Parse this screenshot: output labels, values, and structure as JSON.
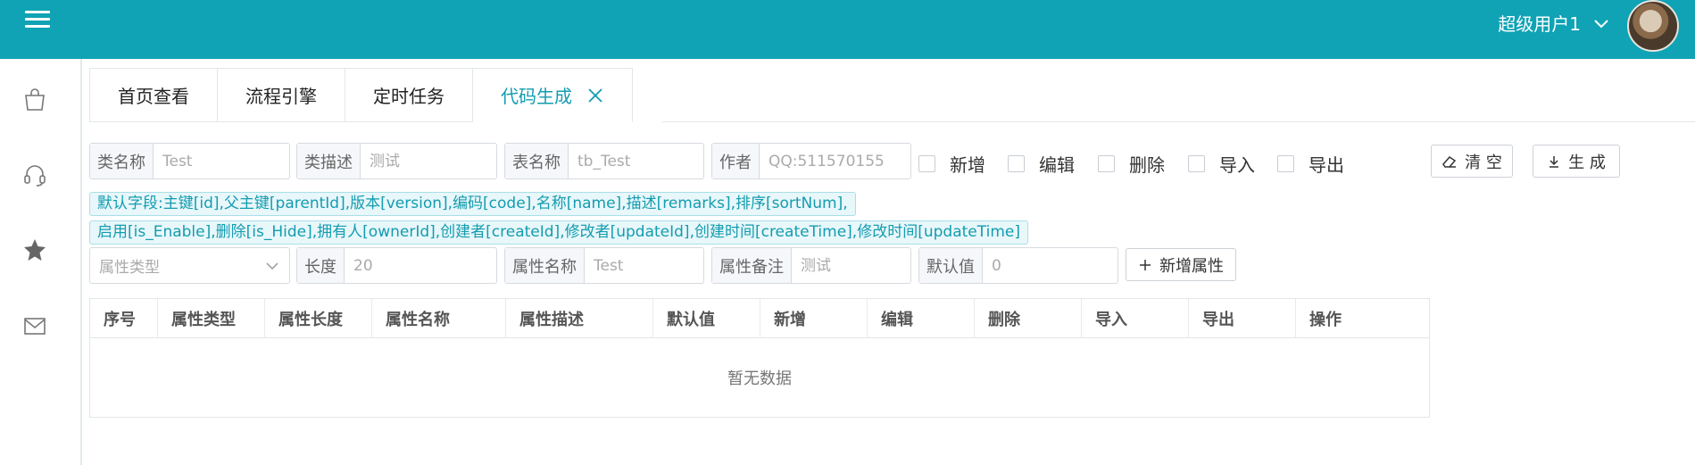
{
  "header": {
    "user_name": "超级用户1",
    "icons": [
      "menu-icon",
      "chevron-down-icon",
      "avatar"
    ]
  },
  "sidebar": {
    "icons": [
      "bag-icon",
      "headset-icon",
      "star-icon",
      "mail-icon"
    ]
  },
  "tabs": [
    {
      "label": "首页查看"
    },
    {
      "label": "流程引擎"
    },
    {
      "label": "定时任务"
    },
    {
      "label": "代码生成",
      "active": true
    }
  ],
  "form": {
    "class_name": {
      "label": "类名称",
      "placeholder": "Test"
    },
    "class_desc": {
      "label": "类描述",
      "placeholder": "测试"
    },
    "table_name": {
      "label": "表名称",
      "placeholder": "tb_Test"
    },
    "author": {
      "label": "作者",
      "placeholder": "QQ:511570155"
    },
    "checks": [
      "新增",
      "编辑",
      "删除",
      "导入",
      "导出"
    ],
    "clear_label": "清 空",
    "generate_label": "生 成"
  },
  "defaults": {
    "line1": "默认字段:主键[id],父主键[parentId],版本[version],编码[code],名称[name],描述[remarks],排序[sortNum],",
    "line2": "启用[is_Enable],删除[is_Hide],拥有人[ownerId],创建者[createId],修改者[updateId],创建时间[createTime],修改时间[updateTime]"
  },
  "attr": {
    "type_placeholder": "属性类型",
    "length": {
      "label": "长度",
      "placeholder": "20"
    },
    "name": {
      "label": "属性名称",
      "placeholder": "Test"
    },
    "remark": {
      "label": "属性备注",
      "placeholder": "测试"
    },
    "default": {
      "label": "默认值",
      "placeholder": "0"
    },
    "add_label": "新增属性"
  },
  "table": {
    "columns": [
      "序号",
      "属性类型",
      "属性长度",
      "属性名称",
      "属性描述",
      "默认值",
      "新增",
      "编辑",
      "删除",
      "导入",
      "导出",
      "操作"
    ],
    "empty_text": "暂无数据"
  },
  "colors": {
    "accent": "#0fa3b5",
    "tag_bg": "#e8f7fa",
    "tag_text": "#139cb0"
  }
}
